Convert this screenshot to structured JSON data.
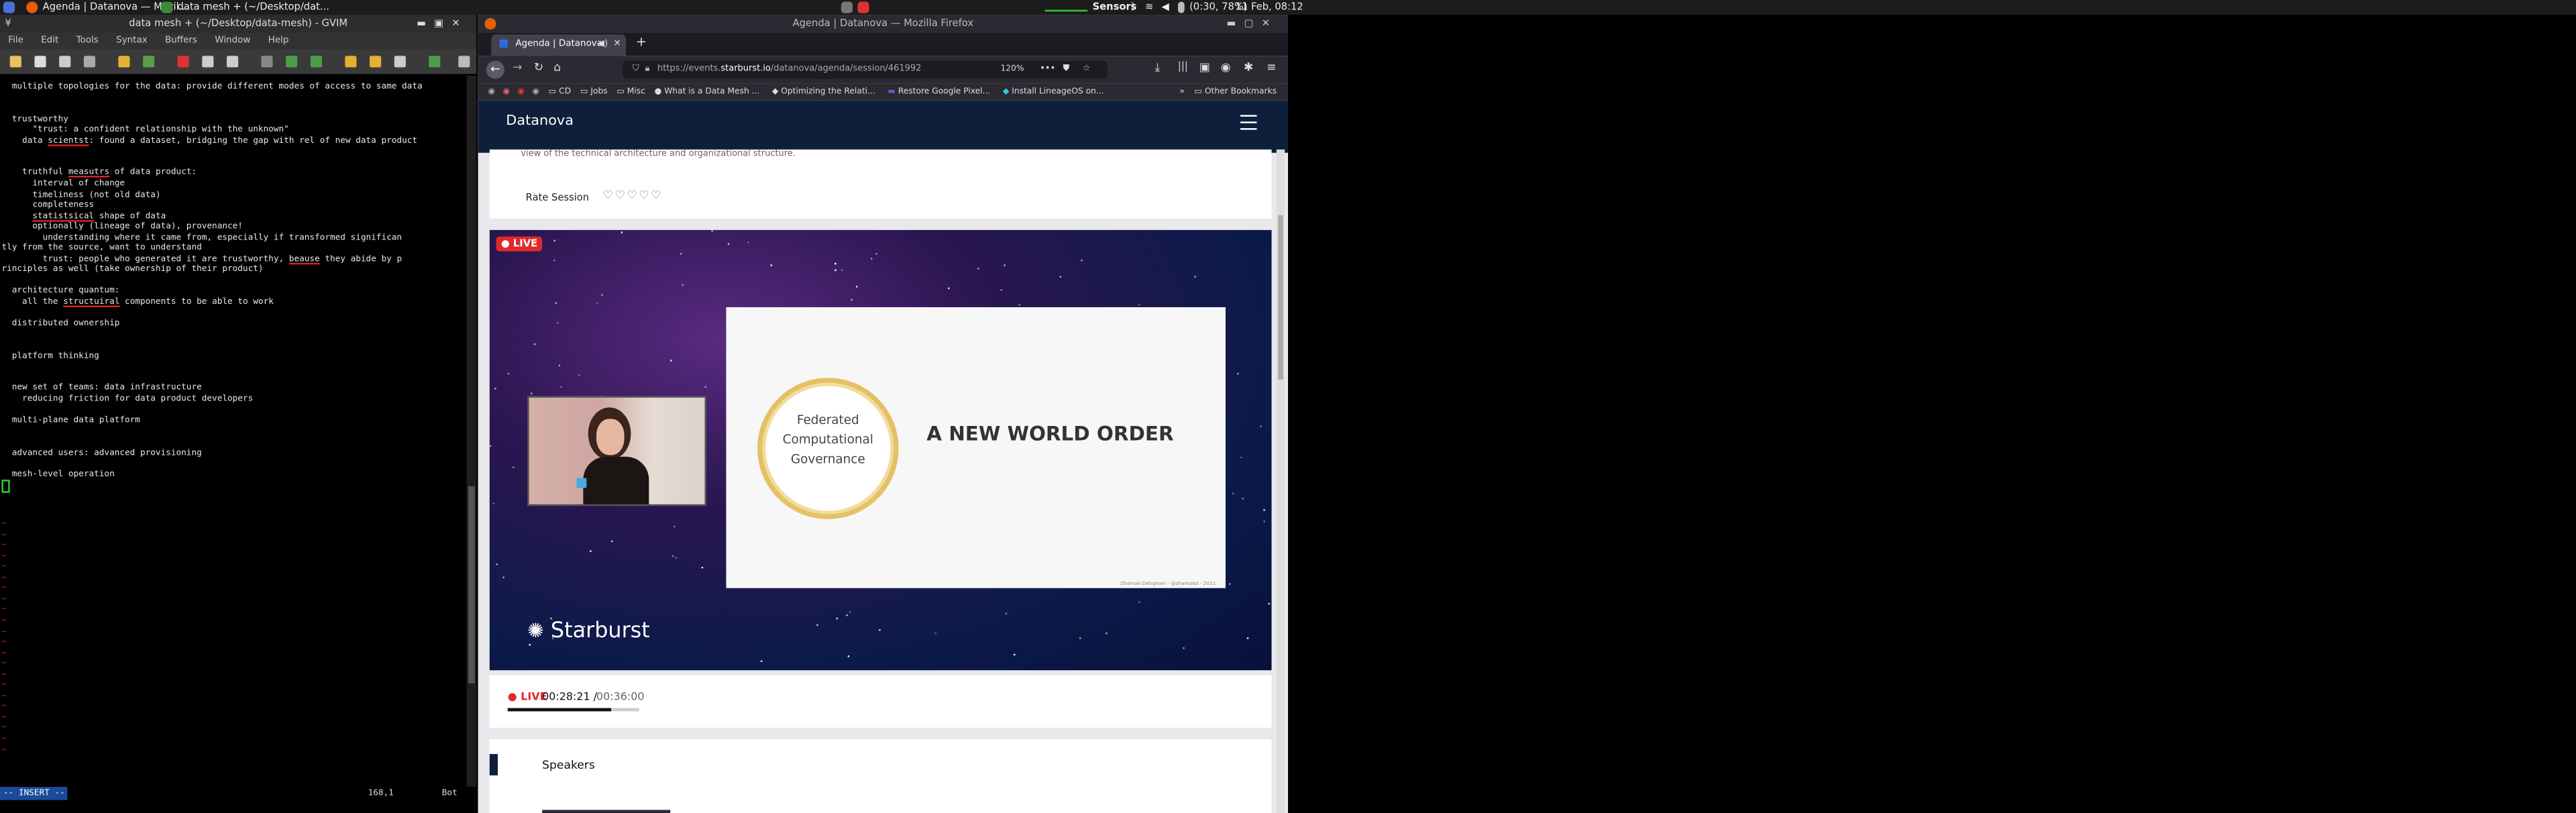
{
  "taskbar": {
    "tasks": [
      "Agenda | Datanova — Mozil...",
      "data mesh + (~/Desktop/dat..."
    ],
    "sensors_label": "Sensors",
    "battery": "(0:30, 78%)",
    "clock": "11 Feb, 08:12"
  },
  "gvim": {
    "title": "data mesh + (~/Desktop/data-mesh) - GVIM",
    "menu": [
      "File",
      "Edit",
      "Tools",
      "Syntax",
      "Buffers",
      "Window",
      "Help"
    ],
    "lines": [
      "  multiple topologies for the data: provide different modes of access to same data",
      "",
      "",
      "  trustworthy",
      "      \"trust: a confident relationship with the unknown\"",
      "    data scientst: found a dataset, bridging the gap with rel of new data product",
      "",
      "",
      "    truthful measutrs of data product:",
      "      interval of change",
      "      timeliness (not old data)",
      "      completeness",
      "      statistsical shape of data",
      "      optionally (lineage of data), provenance!",
      "        understanding where it came from, especially if transformed significan",
      "tly from the source, want to understand",
      "        trust: people who generated it are trustworthy, beause they abide by p",
      "rinciples as well (take ownership of their product)",
      "",
      "  architecture quantum:",
      "    all the structuiral components to be able to work",
      "",
      "  distributed ownership",
      "",
      "",
      "  platform thinking",
      "",
      "",
      "  new set of teams: data infrastructure",
      "    reducing friction for data product developers",
      "",
      "  multi-plane data platform",
      "",
      "",
      "  advanced users: advanced provisioning",
      "",
      "  mesh-level operation",
      "",
      ""
    ],
    "mode": "-- INSERT --",
    "position": "168,1",
    "scroll": "Bot"
  },
  "firefox": {
    "title": "Agenda | Datanova — Mozilla Firefox",
    "tab_label": "Agenda | Datanova",
    "url_prefix": "https://events.",
    "url_domain": "starburst.io",
    "url_path": "/datanova/agenda/session/461992",
    "zoom": "120%",
    "bookmarks": [
      "CD",
      "Jobs",
      "Misc",
      "What is a Data Mesh ...",
      "Optimizing the Relati...",
      "Restore Google Pixel...",
      "Install LineageOS on..."
    ],
    "other_bookmarks": "Other Bookmarks"
  },
  "page": {
    "brand": "Datanova",
    "description_tail": "view of the technical architecture and organizational structure.",
    "rate_label": "Rate Session",
    "live_badge": "LIVE",
    "slide_badge": "Federated Computational Governance",
    "slide_title": "A NEW WORLD ORDER",
    "slide_credit": "Zhamak Dehghani - @zhamakd - 2021",
    "sponsor": "Starburst",
    "player_live": "LIVE",
    "elapsed": "00:28:21 /",
    "duration": "00:36:00",
    "progress": 0.787,
    "speakers_heading": "Speakers"
  },
  "colors": {
    "accent_live": "#e02a2a",
    "navy": "#0e1f3c",
    "gold": "#e5c067"
  }
}
